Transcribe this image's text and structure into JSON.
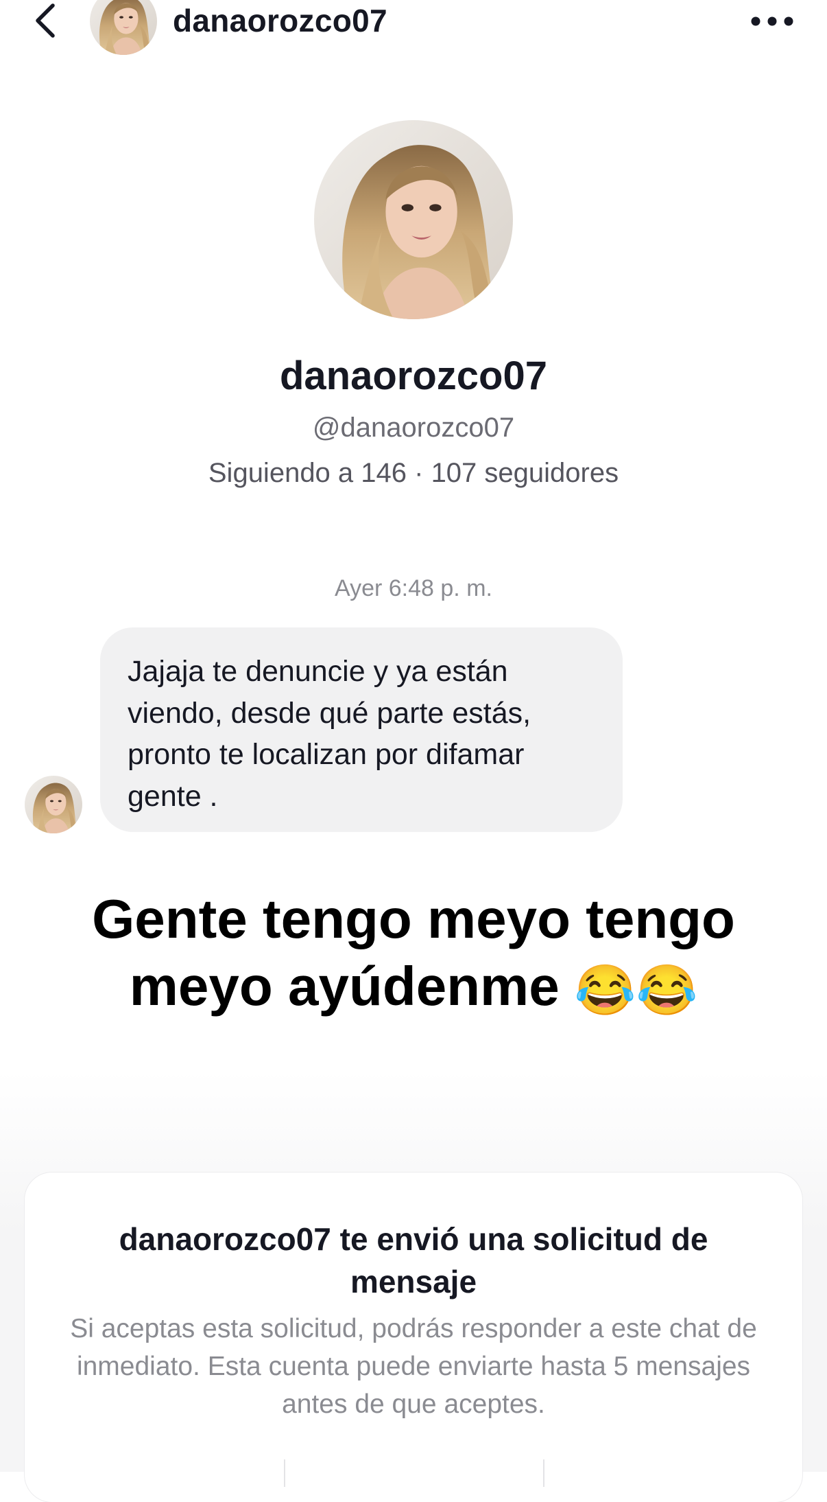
{
  "header": {
    "username": "danaorozco07",
    "back_icon": "chevron-left-icon",
    "more_icon": "more-horizontal-icon"
  },
  "profile": {
    "display_name": "danaorozco07",
    "handle": "@danaorozco07",
    "stats": "Siguiendo a 146 · 107 seguidores"
  },
  "conversation": {
    "timestamp": "Ayer 6:48 p. m.",
    "messages": [
      {
        "text": "Jajaja te denuncie y ya están\nviendo, desde qué parte estás,\npronto te localizan por difamar\ngente ."
      }
    ]
  },
  "caption": {
    "line1": "Gente tengo meyo tengo",
    "line2": "meyo ayúdenme",
    "emoji": "😂😂"
  },
  "request": {
    "title": "danaorozco07 te envió una solicitud de mensaje",
    "body": "Si aceptas esta solicitud, podrás responder a este chat de inmediato. Esta cuenta puede enviarte hasta 5 mensajes antes de que aceptes."
  },
  "colors": {
    "text_primary": "#161823",
    "text_secondary": "#8a8b91",
    "bubble_bg": "#f1f1f2"
  }
}
